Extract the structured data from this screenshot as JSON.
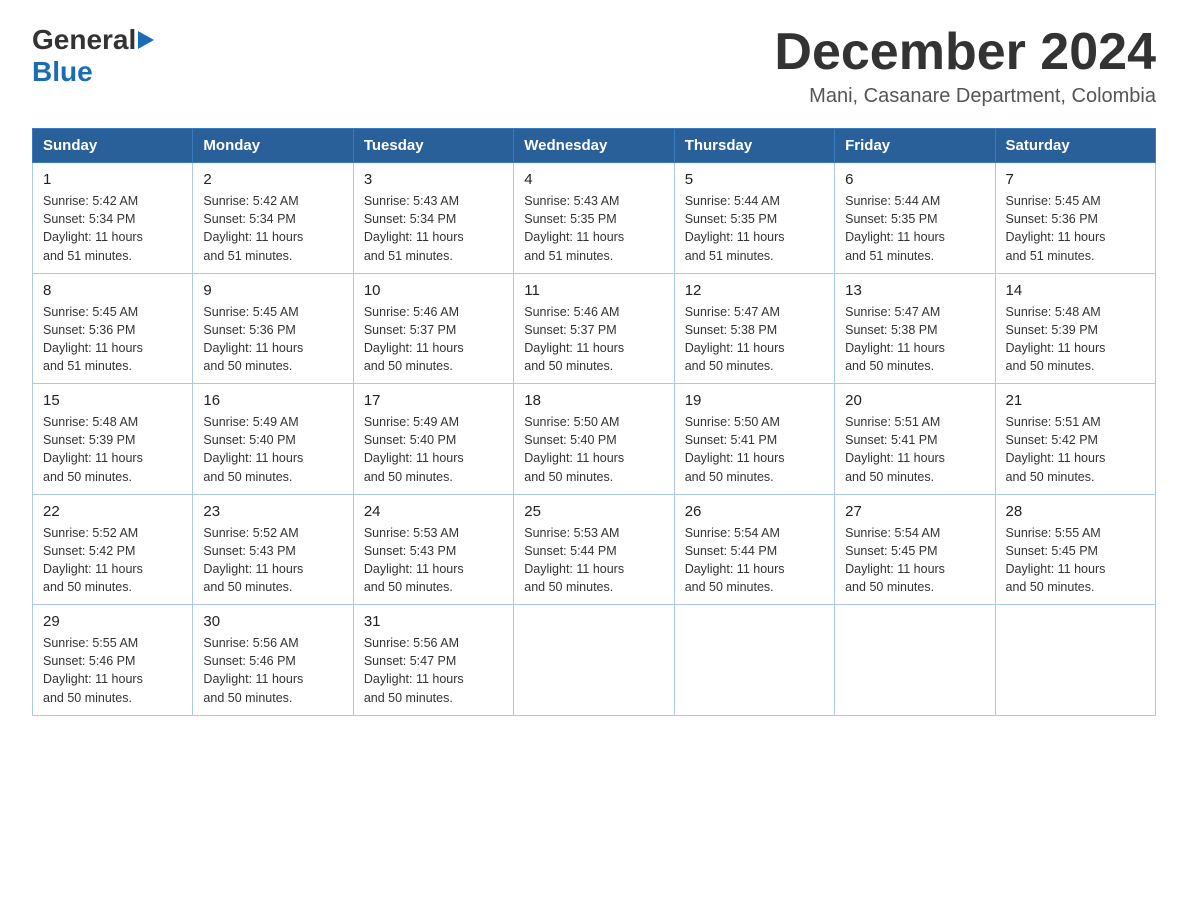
{
  "header": {
    "logo_general": "General",
    "logo_blue": "Blue",
    "month_title": "December 2024",
    "location": "Mani, Casanare Department, Colombia"
  },
  "weekdays": [
    "Sunday",
    "Monday",
    "Tuesday",
    "Wednesday",
    "Thursday",
    "Friday",
    "Saturday"
  ],
  "weeks": [
    [
      {
        "day": "1",
        "sunrise": "5:42 AM",
        "sunset": "5:34 PM",
        "daylight": "11 hours and 51 minutes."
      },
      {
        "day": "2",
        "sunrise": "5:42 AM",
        "sunset": "5:34 PM",
        "daylight": "11 hours and 51 minutes."
      },
      {
        "day": "3",
        "sunrise": "5:43 AM",
        "sunset": "5:34 PM",
        "daylight": "11 hours and 51 minutes."
      },
      {
        "day": "4",
        "sunrise": "5:43 AM",
        "sunset": "5:35 PM",
        "daylight": "11 hours and 51 minutes."
      },
      {
        "day": "5",
        "sunrise": "5:44 AM",
        "sunset": "5:35 PM",
        "daylight": "11 hours and 51 minutes."
      },
      {
        "day": "6",
        "sunrise": "5:44 AM",
        "sunset": "5:35 PM",
        "daylight": "11 hours and 51 minutes."
      },
      {
        "day": "7",
        "sunrise": "5:45 AM",
        "sunset": "5:36 PM",
        "daylight": "11 hours and 51 minutes."
      }
    ],
    [
      {
        "day": "8",
        "sunrise": "5:45 AM",
        "sunset": "5:36 PM",
        "daylight": "11 hours and 51 minutes."
      },
      {
        "day": "9",
        "sunrise": "5:45 AM",
        "sunset": "5:36 PM",
        "daylight": "11 hours and 50 minutes."
      },
      {
        "day": "10",
        "sunrise": "5:46 AM",
        "sunset": "5:37 PM",
        "daylight": "11 hours and 50 minutes."
      },
      {
        "day": "11",
        "sunrise": "5:46 AM",
        "sunset": "5:37 PM",
        "daylight": "11 hours and 50 minutes."
      },
      {
        "day": "12",
        "sunrise": "5:47 AM",
        "sunset": "5:38 PM",
        "daylight": "11 hours and 50 minutes."
      },
      {
        "day": "13",
        "sunrise": "5:47 AM",
        "sunset": "5:38 PM",
        "daylight": "11 hours and 50 minutes."
      },
      {
        "day": "14",
        "sunrise": "5:48 AM",
        "sunset": "5:39 PM",
        "daylight": "11 hours and 50 minutes."
      }
    ],
    [
      {
        "day": "15",
        "sunrise": "5:48 AM",
        "sunset": "5:39 PM",
        "daylight": "11 hours and 50 minutes."
      },
      {
        "day": "16",
        "sunrise": "5:49 AM",
        "sunset": "5:40 PM",
        "daylight": "11 hours and 50 minutes."
      },
      {
        "day": "17",
        "sunrise": "5:49 AM",
        "sunset": "5:40 PM",
        "daylight": "11 hours and 50 minutes."
      },
      {
        "day": "18",
        "sunrise": "5:50 AM",
        "sunset": "5:40 PM",
        "daylight": "11 hours and 50 minutes."
      },
      {
        "day": "19",
        "sunrise": "5:50 AM",
        "sunset": "5:41 PM",
        "daylight": "11 hours and 50 minutes."
      },
      {
        "day": "20",
        "sunrise": "5:51 AM",
        "sunset": "5:41 PM",
        "daylight": "11 hours and 50 minutes."
      },
      {
        "day": "21",
        "sunrise": "5:51 AM",
        "sunset": "5:42 PM",
        "daylight": "11 hours and 50 minutes."
      }
    ],
    [
      {
        "day": "22",
        "sunrise": "5:52 AM",
        "sunset": "5:42 PM",
        "daylight": "11 hours and 50 minutes."
      },
      {
        "day": "23",
        "sunrise": "5:52 AM",
        "sunset": "5:43 PM",
        "daylight": "11 hours and 50 minutes."
      },
      {
        "day": "24",
        "sunrise": "5:53 AM",
        "sunset": "5:43 PM",
        "daylight": "11 hours and 50 minutes."
      },
      {
        "day": "25",
        "sunrise": "5:53 AM",
        "sunset": "5:44 PM",
        "daylight": "11 hours and 50 minutes."
      },
      {
        "day": "26",
        "sunrise": "5:54 AM",
        "sunset": "5:44 PM",
        "daylight": "11 hours and 50 minutes."
      },
      {
        "day": "27",
        "sunrise": "5:54 AM",
        "sunset": "5:45 PM",
        "daylight": "11 hours and 50 minutes."
      },
      {
        "day": "28",
        "sunrise": "5:55 AM",
        "sunset": "5:45 PM",
        "daylight": "11 hours and 50 minutes."
      }
    ],
    [
      {
        "day": "29",
        "sunrise": "5:55 AM",
        "sunset": "5:46 PM",
        "daylight": "11 hours and 50 minutes."
      },
      {
        "day": "30",
        "sunrise": "5:56 AM",
        "sunset": "5:46 PM",
        "daylight": "11 hours and 50 minutes."
      },
      {
        "day": "31",
        "sunrise": "5:56 AM",
        "sunset": "5:47 PM",
        "daylight": "11 hours and 50 minutes."
      },
      null,
      null,
      null,
      null
    ]
  ],
  "labels": {
    "sunrise": "Sunrise:",
    "sunset": "Sunset:",
    "daylight": "Daylight:"
  }
}
